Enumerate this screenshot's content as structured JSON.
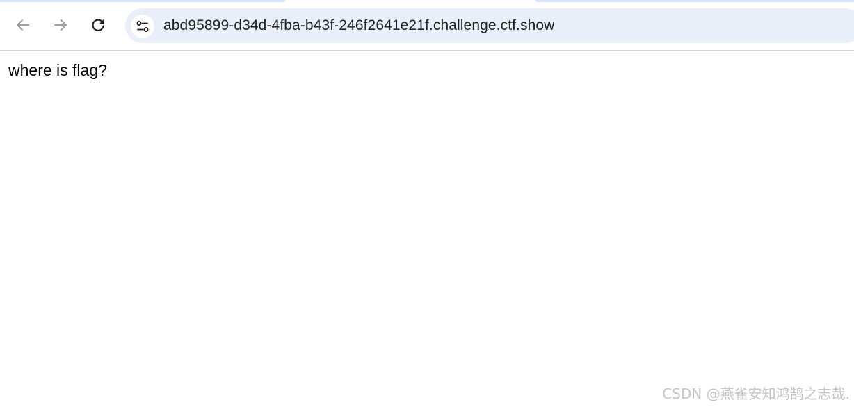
{
  "browser": {
    "toolbar": {
      "back_icon": "arrow-left-icon",
      "forward_icon": "arrow-right-icon",
      "reload_icon": "reload-icon",
      "site_info_icon": "tune-icon"
    },
    "omnibox": {
      "url": "abd95899-d34d-4fba-b43f-246f2641e21f.challenge.ctf.show"
    },
    "colors": {
      "omnibox_bg": "#e9eff8",
      "tab_accent": "#d3e3fd",
      "icon_active": "#1f1f1f",
      "icon_disabled": "#9aa0a6"
    }
  },
  "page": {
    "text": "where is flag?"
  },
  "watermark": {
    "text": "CSDN @燕雀安知鸿鹄之志哉."
  }
}
